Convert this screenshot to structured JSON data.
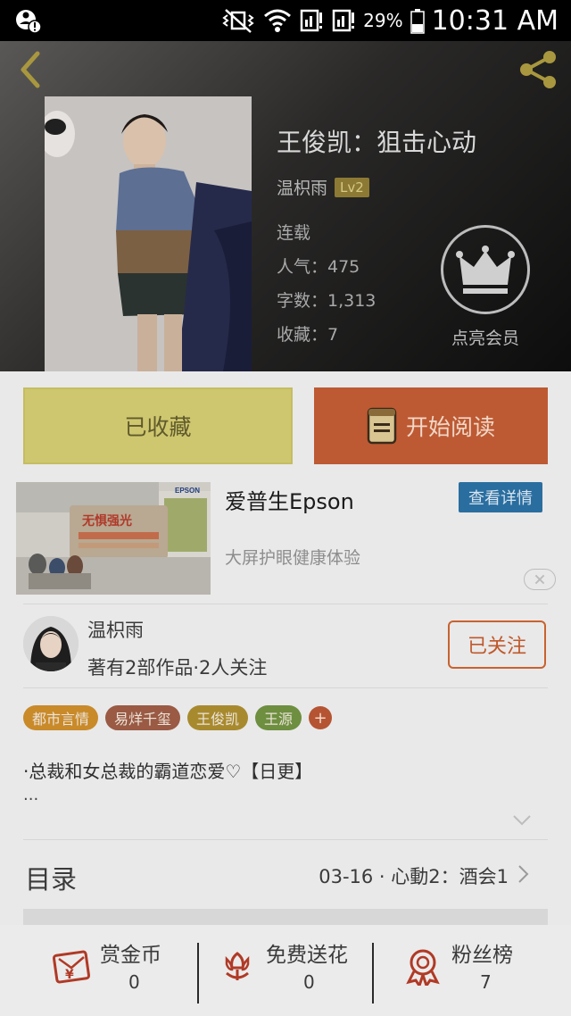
{
  "status_bar": {
    "battery_percent": "29%",
    "time": "10:31 AM"
  },
  "header": {
    "title": "王俊凯：狙击心动",
    "author": "温枳雨",
    "level": "Lv2",
    "status": "连载",
    "popularity": "人气：475",
    "word_count": "字数：1,313",
    "favorites": "收藏：7",
    "vip_label": "点亮会员"
  },
  "actions": {
    "collected_label": "已收藏",
    "read_label": "开始阅读"
  },
  "ad": {
    "title": "爱普生Epson",
    "detail_label": "查看详情",
    "description": "大屏护眼健康体验",
    "brand_mark": "EPSON",
    "headline": "无惧强光"
  },
  "author_card": {
    "name": "温枳雨",
    "stats": "著有2部作品·2人关注",
    "follow_label": "已关注"
  },
  "tags": [
    {
      "label": "都市言情",
      "color": "#c98a2a"
    },
    {
      "label": "易烊千玺",
      "color": "#9a5a44"
    },
    {
      "label": "王俊凯",
      "color": "#a88a2e"
    },
    {
      "label": "王源",
      "color": "#6d8f3f"
    }
  ],
  "tag_add": "+",
  "description": {
    "text": "·总裁和女总裁的霸道恋爱♡【日更】",
    "more": "..."
  },
  "toc": {
    "label": "目录",
    "latest": "03-16 · 心動2：酒会1"
  },
  "bottom_bar": {
    "items": [
      {
        "label": "赏金币",
        "count": "0",
        "icon": "red-envelope-icon"
      },
      {
        "label": "免费送花",
        "count": "0",
        "icon": "flower-icon"
      },
      {
        "label": "粉丝榜",
        "count": "7",
        "icon": "medal-icon"
      }
    ]
  },
  "colors": {
    "accent_orange": "#bd5a33",
    "collected_yellow": "#cfc76f",
    "ad_blue": "#2a6ea0",
    "icon_red": "#b03a26"
  }
}
